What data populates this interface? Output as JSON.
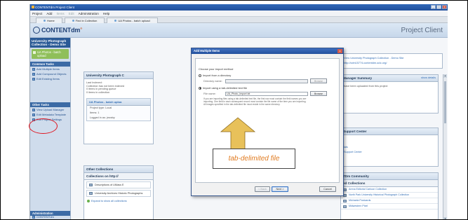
{
  "window": {
    "title": "CONTENTdm Project Client",
    "controls": [
      "_",
      "□",
      "x"
    ]
  },
  "menu": [
    "Project",
    "Add",
    "Items",
    "Edit",
    "Administration",
    "Help"
  ],
  "tabs": [
    "Home",
    "Find in Collection",
    "UA Photos - batch upload"
  ],
  "header": {
    "logo_text": "CONTENTdm",
    "logo_sup": "®",
    "title": "Project Client"
  },
  "sidebar": {
    "collection_title": "University Photograph Collection - Demo Site",
    "selected_project": "UA Photos - batch upload",
    "common_tasks_title": "Common Tasks",
    "common_tasks": [
      "Add Multiple Items",
      "Add Compound Objects",
      "Edit Existing Items"
    ],
    "other_tasks_title": "Other Tasks",
    "other_tasks": [
      "View Upload Manager",
      "Edit Metadata Template",
      "Edit Project Settings"
    ],
    "admin_title": "Administration",
    "admin_item": "CONTENTdm"
  },
  "main": {
    "left_panel_title": "University Photograph C",
    "left_panel_lines": [
      "Last Indexed:",
      "Collection has not been indexed",
      "0 items in pending queue",
      "0 items in collection"
    ],
    "project_panel_title": "UA Photos - batch uploa",
    "project_kv": [
      "Project type:  Local",
      "Items:  1",
      "Logged in as:  jmcsby"
    ],
    "other_collections_title": "Other Collections",
    "collections_on_title": "Collections on http://",
    "collections": [
      "Descriptions of UMass E",
      "University Archives Historic Photographs"
    ],
    "expand_label": "Expand to show all collections",
    "right_top_links": [
      "View University Photograph Collection - Demo Site",
      "http://cdm15774.contentdm.oclc.org/"
    ],
    "manager_summary_title": "Manager Summary",
    "manager_more": "show details",
    "manager_text": "have been uploaded from this project",
    "support_title": "Support Center",
    "support_links": [
      "ials",
      "Support Center"
    ],
    "community_title": "TDm Community",
    "featured_title": "ed Collections",
    "featured": [
      "Arena Editorial Cartoon Collection",
      "North Park University Historical Photograph Collection",
      "Michaela Postcards",
      "Midwestern Pixel"
    ]
  },
  "dialog": {
    "title": "Add Multiple Items",
    "close": "x",
    "prompt": "Choose your import method",
    "option_directory": "Import from a directory",
    "directory_label": "Directory name:",
    "directory_value": "",
    "browse": "Browse",
    "option_tab": "Import using a tab-delimited text file",
    "file_label": "File name:",
    "file_value": "UA_Photo_Import.txt",
    "note": "If you are importing files using a tab-delimited text file, the first row must contain the field names you are importing. One field in each subsequent record must contain the file name of the item you are importing. All images specified in the tab-delimited file must reside in the same directory.",
    "back": "< Back",
    "next": "Next >",
    "cancel": "Cancel"
  },
  "annotation": {
    "callout_text": "tab-delimited file",
    "arrow_color": "#e8c15a",
    "circle_color": "#e0141e"
  }
}
